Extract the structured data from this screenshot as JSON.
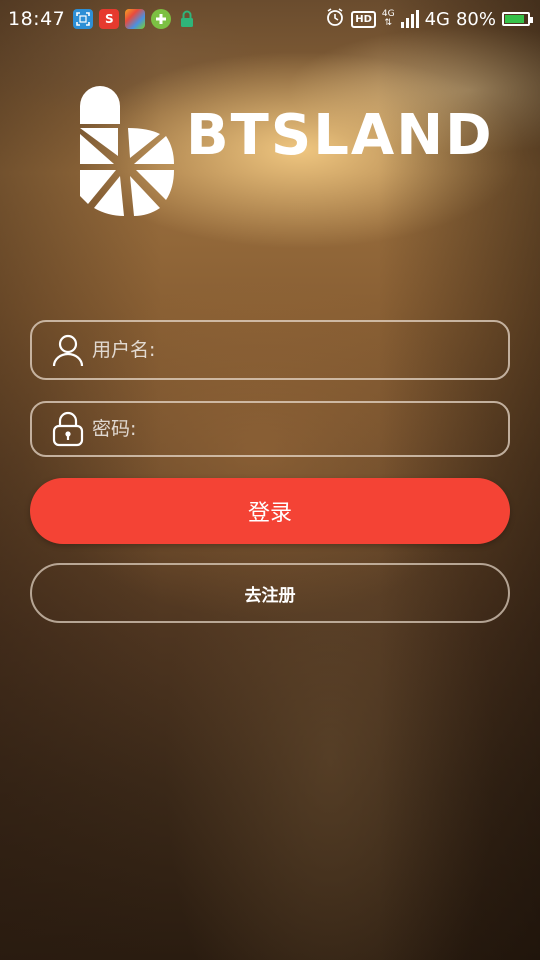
{
  "status_bar": {
    "time": "18:47",
    "left_icons": [
      "screenshot-icon",
      "sogou-icon",
      "app-store-icon",
      "game-icon",
      "lock-icon"
    ],
    "network_small": "4G",
    "network": "4G",
    "battery": "80%",
    "battery_level": 0.8,
    "hd_label": "HD",
    "right_icons": [
      "alarm-icon",
      "hd-icon",
      "signal-icon",
      "battery-icon"
    ]
  },
  "logo": {
    "text": "BTSLAND"
  },
  "login_form": {
    "username_placeholder": "用户名:",
    "password_placeholder": "密码:",
    "login_label": "登录",
    "register_label": "去注册"
  },
  "colors": {
    "primary_button": "#f44335",
    "text": "#ffffff",
    "battery_green": "#37c24a"
  }
}
